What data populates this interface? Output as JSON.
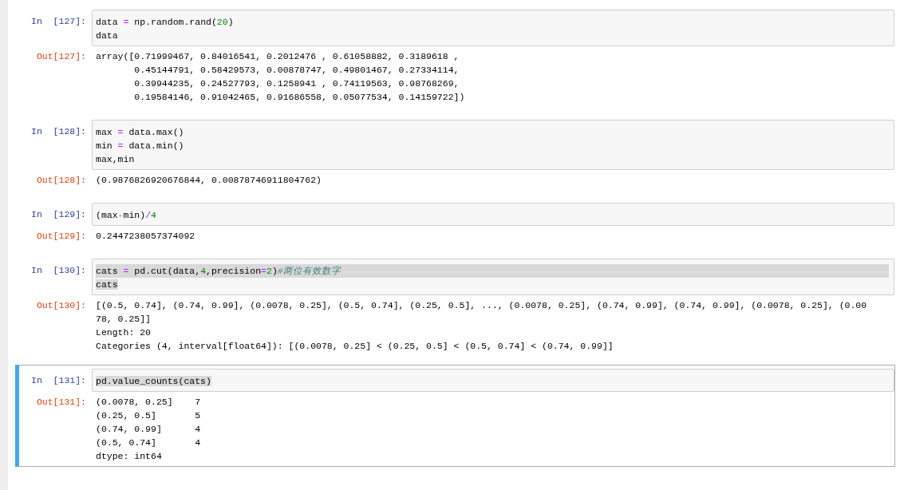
{
  "cells": [
    {
      "in_prompt": "In  [127]:",
      "selected": false,
      "code": [
        {
          "text": "data = np.random.rand(20)",
          "line_highlighted": false,
          "text_selected": false
        },
        {
          "text": "data",
          "line_highlighted": false,
          "text_selected": false
        }
      ],
      "out_prompt": "Out[127]:",
      "output": [
        "array([0.71999467, 0.84016541, 0.2012476 , 0.61058882, 0.3189618 ,",
        "       0.45144791, 0.58429573, 0.00878747, 0.49801467, 0.27334114,",
        "       0.39944235, 0.24527793, 0.1258941 , 0.74119563, 0.98768269,",
        "       0.19584146, 0.91042465, 0.91686558, 0.05077534, 0.14159722])"
      ]
    },
    {
      "in_prompt": "In  [128]:",
      "selected": false,
      "code": [
        {
          "text": "max = data.max()",
          "line_highlighted": false,
          "text_selected": false
        },
        {
          "text": "min = data.min()",
          "line_highlighted": false,
          "text_selected": false
        },
        {
          "text": "max,min",
          "line_highlighted": false,
          "text_selected": false
        }
      ],
      "out_prompt": "Out[128]:",
      "output": [
        "(0.9876826920676844, 0.00878746911804762)"
      ]
    },
    {
      "in_prompt": "In  [129]:",
      "selected": false,
      "code": [
        {
          "text": "(max-min)/4",
          "line_highlighted": false,
          "text_selected": false
        }
      ],
      "out_prompt": "Out[129]:",
      "output": [
        "0.2447238057374092"
      ]
    },
    {
      "in_prompt": "In  [130]:",
      "selected": false,
      "code": [
        {
          "text": "cats = pd.cut(data,4,precision=2)#两位有效数字",
          "line_highlighted": true,
          "text_selected": true
        },
        {
          "text": "cats",
          "line_highlighted": false,
          "text_selected": true
        }
      ],
      "out_prompt": "Out[130]:",
      "output": [
        "[(0.5, 0.74], (0.74, 0.99], (0.0078, 0.25], (0.5, 0.74], (0.25, 0.5], ..., (0.0078, 0.25], (0.74, 0.99], (0.74, 0.99], (0.0078, 0.25], (0.00",
        "78, 0.25]]",
        "Length: 20",
        "Categories (4, interval[float64]): [(0.0078, 0.25] < (0.25, 0.5] < (0.5, 0.74] < (0.74, 0.99]]"
      ]
    },
    {
      "in_prompt": "In  [131]:",
      "selected": true,
      "code": [
        {
          "text": "pd.value_counts(cats)",
          "line_highlighted": false,
          "text_selected": true
        }
      ],
      "out_prompt": "Out[131]:",
      "output": [
        "(0.0078, 0.25]    7",
        "(0.25, 0.5]       5",
        "(0.74, 0.99]      4",
        "(0.5, 0.74]       4",
        "dtype: int64"
      ]
    }
  ]
}
